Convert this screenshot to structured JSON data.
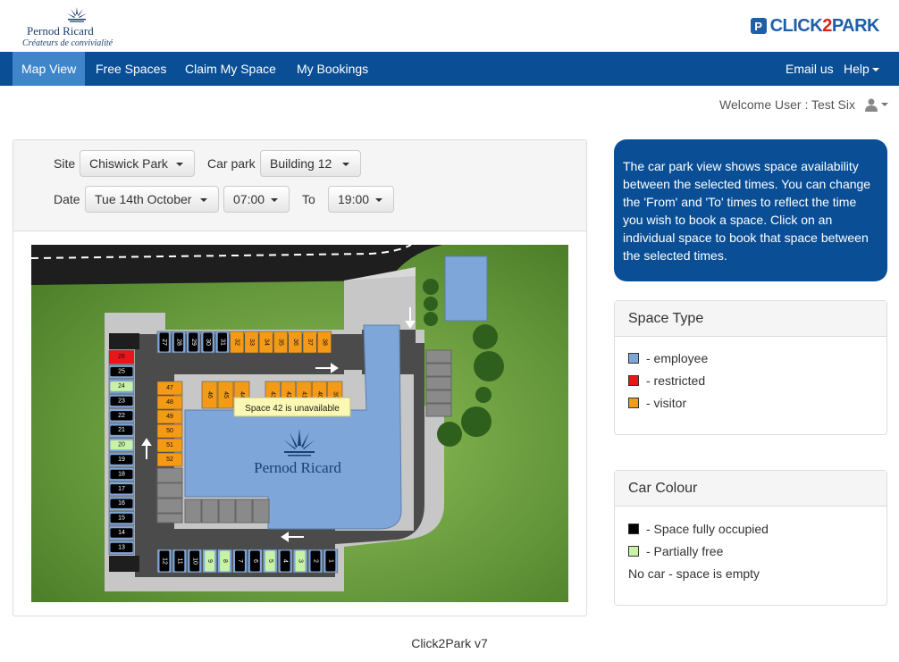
{
  "brand": {
    "company_name": "Pernod Ricard",
    "company_tagline": "Créateurs de convivialité",
    "app_logo_prefix": "CLICK",
    "app_logo_two": "2",
    "app_logo_suffix": "PARK",
    "app_logo_badge": "P"
  },
  "nav": {
    "items": [
      {
        "label": "Map View",
        "active": true
      },
      {
        "label": "Free Spaces"
      },
      {
        "label": "Claim My Space"
      },
      {
        "label": "My Bookings"
      }
    ],
    "right": [
      {
        "label": "Email us"
      },
      {
        "label": "Help"
      }
    ]
  },
  "welcome": "Welcome User : Test Six",
  "form": {
    "site_label": "Site",
    "site_value": "Chiswick Park",
    "carpark_label": "Car park",
    "carpark_value": "Building 12",
    "date_label": "Date",
    "date_value": "Tue 14th October",
    "from_value": "07:00",
    "to_label": "To",
    "to_value": "19:00"
  },
  "map": {
    "tooltip": "Space 42 is unavailable",
    "building_label": "Pernod Ricard",
    "left_column": [
      {
        "num": "26",
        "type": "restricted",
        "car": "none"
      },
      {
        "num": "25",
        "type": "employee",
        "car": "occupied"
      },
      {
        "num": "24",
        "type": "employee",
        "car": "partial"
      },
      {
        "num": "23",
        "type": "employee",
        "car": "occupied"
      },
      {
        "num": "22",
        "type": "employee",
        "car": "occupied"
      },
      {
        "num": "21",
        "type": "employee",
        "car": "occupied"
      },
      {
        "num": "20",
        "type": "employee",
        "car": "partial"
      },
      {
        "num": "19",
        "type": "employee",
        "car": "occupied"
      },
      {
        "num": "18",
        "type": "employee",
        "car": "occupied"
      },
      {
        "num": "17",
        "type": "employee",
        "car": "occupied"
      },
      {
        "num": "16",
        "type": "employee",
        "car": "occupied"
      },
      {
        "num": "15",
        "type": "employee",
        "car": "occupied"
      },
      {
        "num": "14",
        "type": "employee",
        "car": "occupied"
      },
      {
        "num": "13",
        "type": "employee",
        "car": "occupied"
      }
    ],
    "top_row": [
      {
        "num": "27",
        "type": "employee",
        "car": "occupied"
      },
      {
        "num": "28",
        "type": "employee",
        "car": "occupied"
      },
      {
        "num": "29",
        "type": "employee",
        "car": "occupied"
      },
      {
        "num": "30",
        "type": "employee",
        "car": "occupied"
      },
      {
        "num": "31",
        "type": "employee",
        "car": "occupied"
      },
      {
        "num": "32",
        "type": "visitor",
        "car": "none"
      },
      {
        "num": "33",
        "type": "visitor",
        "car": "none"
      },
      {
        "num": "34",
        "type": "visitor",
        "car": "none"
      },
      {
        "num": "35",
        "type": "visitor",
        "car": "none"
      },
      {
        "num": "36",
        "type": "visitor",
        "car": "none"
      },
      {
        "num": "37",
        "type": "visitor",
        "car": "none"
      },
      {
        "num": "38",
        "type": "visitor",
        "car": "none"
      }
    ],
    "inner_column": [
      {
        "num": "47",
        "type": "visitor"
      },
      {
        "num": "48",
        "type": "visitor"
      },
      {
        "num": "49",
        "type": "visitor"
      },
      {
        "num": "50",
        "type": "visitor"
      },
      {
        "num": "51",
        "type": "visitor"
      },
      {
        "num": "52",
        "type": "visitor"
      }
    ],
    "inner_row": [
      {
        "num": "46",
        "type": "visitor"
      },
      {
        "num": "45",
        "type": "visitor"
      },
      {
        "num": "44",
        "type": "visitor"
      },
      {
        "num": "43",
        "type": "visitor"
      },
      {
        "num": "42",
        "type": "visitor"
      },
      {
        "num": "41",
        "type": "visitor"
      },
      {
        "num": "40",
        "type": "visitor"
      },
      {
        "num": "39",
        "type": "visitor"
      }
    ],
    "bottom_row": [
      {
        "num": "12",
        "type": "employee",
        "car": "occupied"
      },
      {
        "num": "11",
        "type": "employee",
        "car": "occupied"
      },
      {
        "num": "10",
        "type": "employee",
        "car": "occupied"
      },
      {
        "num": "9",
        "type": "employee",
        "car": "partial"
      },
      {
        "num": "8",
        "type": "employee",
        "car": "partial"
      },
      {
        "num": "7",
        "type": "employee",
        "car": "occupied"
      },
      {
        "num": "6",
        "type": "employee",
        "car": "occupied"
      },
      {
        "num": "5",
        "type": "employee",
        "car": "partial"
      },
      {
        "num": "4",
        "type": "employee",
        "car": "occupied"
      },
      {
        "num": "3",
        "type": "employee",
        "car": "partial"
      },
      {
        "num": "2",
        "type": "employee",
        "car": "occupied"
      },
      {
        "num": "1",
        "type": "employee",
        "car": "occupied"
      }
    ]
  },
  "info_text": "The car park view shows space availability between the selected times. You can change the 'From' and 'To' times to reflect the time you wish to book a space. Click on an individual space to book that space between the selected times.",
  "space_type": {
    "title": "Space Type",
    "items": [
      {
        "label": "- employee",
        "color": "#7ea6d8"
      },
      {
        "label": "- restricted",
        "color": "#e8161a"
      },
      {
        "label": "- visitor",
        "color": "#f59a16"
      }
    ]
  },
  "car_colour": {
    "title": "Car Colour",
    "items": [
      {
        "label": "- Space fully occupied",
        "color": "#000000"
      },
      {
        "label": "- Partially free",
        "color": "#c8f2a6"
      }
    ],
    "note": "No car - space is empty"
  },
  "colors": {
    "employee": "#7ea6d8",
    "restricted": "#e8161a",
    "visitor": "#f59a16",
    "occupied": "#000000",
    "partial": "#c8f2a6",
    "nav": "#0a4f96",
    "nav_active": "#3f85c9"
  },
  "footer": "Click2Park v7"
}
